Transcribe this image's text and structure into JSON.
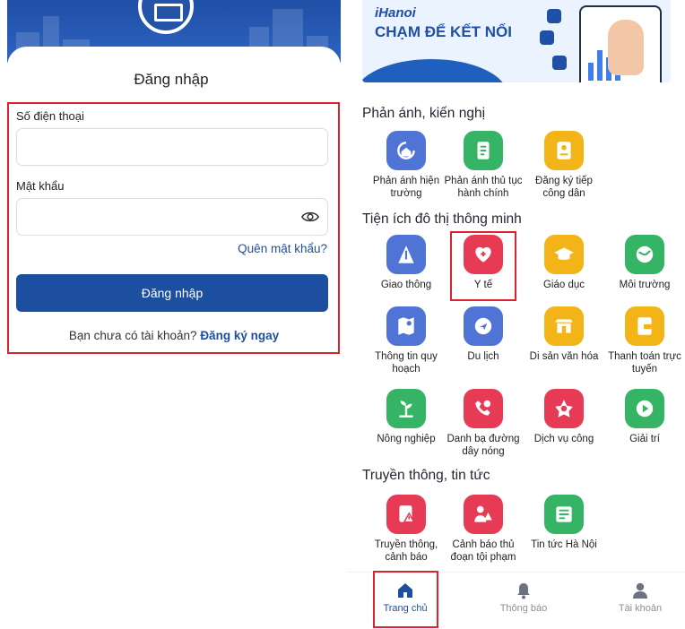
{
  "login": {
    "title": "Đăng nhập",
    "phone_label": "Số điện thoại",
    "phone_value": "",
    "password_label": "Mật khẩu",
    "password_value": "",
    "forgot": "Quên mật khẩu?",
    "submit": "Đăng nhập",
    "no_account": "Bạn chưa có tài khoản?",
    "signup": "Đăng ký ngay"
  },
  "banner": {
    "brand": "iHanoi",
    "slogan": "CHẠM ĐỂ KẾT NỐI"
  },
  "sections": [
    {
      "title": "Phản ánh, kiến nghị",
      "items": [
        {
          "label": "Phản ánh hiện trường",
          "icon": "refresh-house-icon",
          "color": "#4f74d6"
        },
        {
          "label": "Phản ánh thủ tục hành chính",
          "icon": "document-icon",
          "color": "#34b464"
        },
        {
          "label": "Đăng ký tiếp công dân",
          "icon": "id-card-icon",
          "color": "#f2b417"
        }
      ]
    },
    {
      "title": "Tiện ích đô thị thông minh",
      "items": [
        {
          "label": "Giao thông",
          "icon": "traffic-icon",
          "color": "#4f74d6"
        },
        {
          "label": "Y tế",
          "icon": "heart-plus-icon",
          "color": "#e63a55"
        },
        {
          "label": "Giáo dục",
          "icon": "graduation-cap-icon",
          "color": "#f2b417"
        },
        {
          "label": "Môi trường",
          "icon": "globe-leaf-icon",
          "color": "#34b464"
        },
        {
          "label": "Thông tin quy hoạch",
          "icon": "map-pin-icon",
          "color": "#4f74d6"
        },
        {
          "label": "Du lịch",
          "icon": "globe-plane-icon",
          "color": "#4f74d6"
        },
        {
          "label": "Di sản văn hóa",
          "icon": "temple-icon",
          "color": "#f2b417"
        },
        {
          "label": "Thanh toán trực tuyến",
          "icon": "wallet-icon",
          "color": "#f2b417"
        },
        {
          "label": "Nông nghiệp",
          "icon": "plant-icon",
          "color": "#34b464"
        },
        {
          "label": "Danh bạ đường dây nóng",
          "icon": "phone-chat-icon",
          "color": "#e63a55"
        },
        {
          "label": "Dịch vụ công",
          "icon": "star-knot-icon",
          "color": "#e63a55"
        },
        {
          "label": "Giải trí",
          "icon": "play-icon",
          "color": "#34b464"
        }
      ]
    },
    {
      "title": "Truyền thông, tin tức",
      "items": [
        {
          "label": "Truyền thông, cảnh báo",
          "icon": "warning-doc-icon",
          "color": "#e63a55"
        },
        {
          "label": "Cảnh báo thủ đoạn tội phạm",
          "icon": "alert-person-icon",
          "color": "#e63a55"
        },
        {
          "label": "Tin tức Hà Nội",
          "icon": "news-icon",
          "color": "#34b464"
        }
      ]
    }
  ],
  "nav": [
    {
      "label": "Trang chủ",
      "icon": "home-icon",
      "active": true
    },
    {
      "label": "Thông báo",
      "icon": "bell-icon",
      "active": false
    },
    {
      "label": "Tài khoản",
      "icon": "user-icon",
      "active": false
    }
  ],
  "colors": {
    "primary": "#1d4fa0",
    "highlight": "#d9232d",
    "blue": "#4f74d6",
    "green": "#34b464",
    "yellow": "#f2b417",
    "red": "#e63a55"
  }
}
